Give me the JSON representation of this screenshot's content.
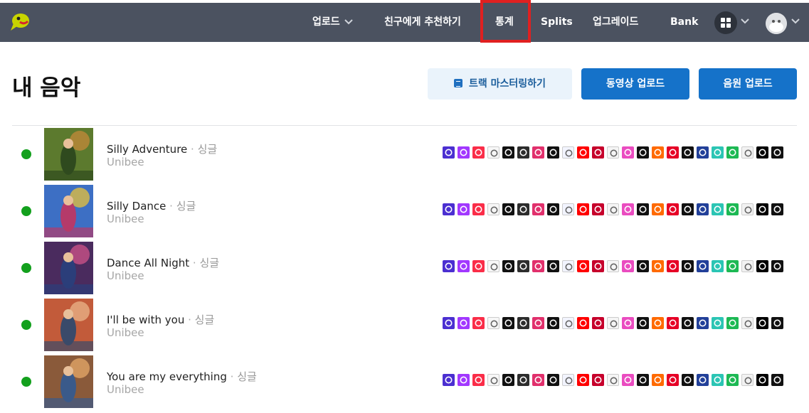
{
  "nav": {
    "items": [
      {
        "label": "업로드",
        "dropdown": true
      },
      {
        "label": "친구에게 추천하기",
        "dropdown": false
      },
      {
        "label": "통계",
        "dropdown": false,
        "highlighted": true
      },
      {
        "label": "Splits",
        "dropdown": false
      },
      {
        "label": "업그레이드",
        "dropdown": false
      },
      {
        "label": "Bank",
        "dropdown": false
      }
    ],
    "highlight_color": "#e02020",
    "bar_color": "#4b5260"
  },
  "header": {
    "title": "내 음악",
    "master_button": "트랙 마스터링하기",
    "video_upload_button": "동영상 업로드",
    "audio_upload_button": "음원 업로드"
  },
  "tracks": [
    {
      "title": "Silly Adventure",
      "separator": " · ",
      "type": "싱글",
      "artist": "Unibee",
      "status_color": "#13a01d"
    },
    {
      "title": "Silly Dance",
      "separator": " · ",
      "type": "싱글",
      "artist": "Unibee",
      "status_color": "#13a01d"
    },
    {
      "title": "Dance All Night",
      "separator": " · ",
      "type": "싱글",
      "artist": "Unibee",
      "status_color": "#13a01d"
    },
    {
      "title": "I'll be with you",
      "separator": " · ",
      "type": "싱글",
      "artist": "Unibee",
      "status_color": "#13a01d"
    },
    {
      "title": "You are my everything",
      "separator": " · ",
      "type": "싱글",
      "artist": "Unibee",
      "status_color": "#13a01d"
    }
  ],
  "stores": [
    {
      "icon": "amazon-music-icon",
      "color": "#4b2fd1"
    },
    {
      "icon": "deezer-icon",
      "color": "#a238ff"
    },
    {
      "icon": "apple-music-icon",
      "color": "#fa2d48"
    },
    {
      "icon": "anghami-icon",
      "color": "#f7f7f7"
    },
    {
      "icon": "boomplay-icon",
      "color": "#111111"
    },
    {
      "icon": "audiomack-icon",
      "color": "#2d2d2d"
    },
    {
      "icon": "instagram-icon",
      "color": "#e1306c"
    },
    {
      "icon": "napster-icon",
      "color": "#111111"
    },
    {
      "icon": "flo-icon",
      "color": "#f2f4ff"
    },
    {
      "icon": "youtube-music-icon",
      "color": "#ff0000"
    },
    {
      "icon": "iheartradio-icon",
      "color": "#c6002b"
    },
    {
      "icon": "kkbox-icon",
      "color": "#f5f5f5"
    },
    {
      "icon": "itunes-icon",
      "color": "#ea4cc0"
    },
    {
      "icon": "melon-icon",
      "color": "#111111"
    },
    {
      "icon": "soundcloud-icon",
      "color": "#ff6a00"
    },
    {
      "icon": "netease-icon",
      "color": "#e60026"
    },
    {
      "icon": "shazam-icon",
      "color": "#111111"
    },
    {
      "icon": "pandora-icon",
      "color": "#224099"
    },
    {
      "icon": "jiosaavn-icon",
      "color": "#2bc5b4"
    },
    {
      "icon": "spotify-icon",
      "color": "#1db954"
    },
    {
      "icon": "yandex-icon",
      "color": "#f2f2f2"
    },
    {
      "icon": "tidal-icon",
      "color": "#000000"
    },
    {
      "icon": "tiktok-icon",
      "color": "#111111"
    }
  ]
}
